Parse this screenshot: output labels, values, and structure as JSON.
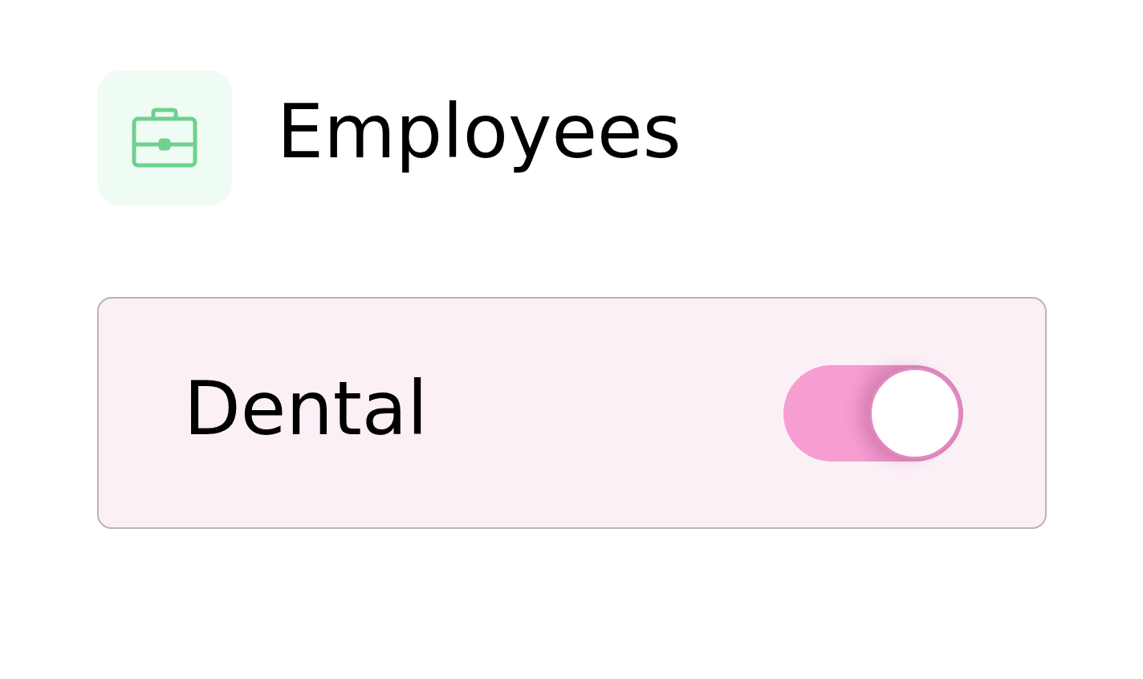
{
  "header": {
    "title": "Employees"
  },
  "setting": {
    "label": "Dental",
    "on": true
  }
}
